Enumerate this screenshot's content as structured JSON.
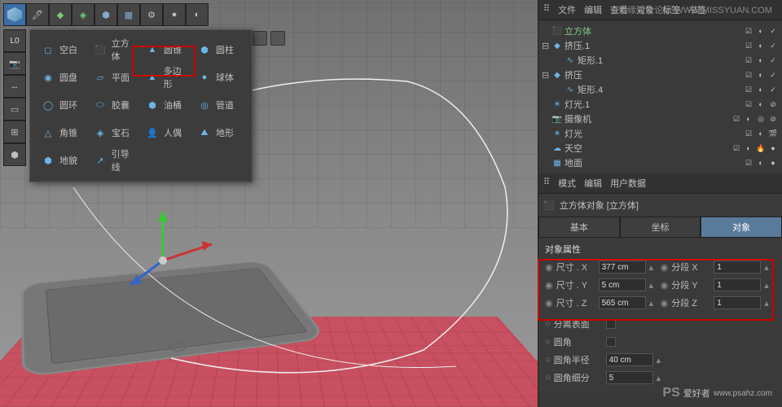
{
  "watermark_top": "思缘设计论坛  WWW.MISSYUAN.COM",
  "watermark_bottom": {
    "ps": "PS",
    "text": "爱好者",
    "url": "www.psahz.com"
  },
  "toolbar_side": [
    "L0",
    "cam",
    "move",
    "sel",
    "scale"
  ],
  "popup": {
    "rows": [
      [
        {
          "icon": "◻",
          "label": "空白"
        },
        {
          "icon": "⬛",
          "label": "立方体"
        },
        {
          "icon": "▲",
          "label": "圆锥"
        },
        {
          "icon": "⬢",
          "label": "圆柱"
        }
      ],
      [
        {
          "icon": "◉",
          "label": "圆盘"
        },
        {
          "icon": "▱",
          "label": "平面"
        },
        {
          "icon": "▲",
          "label": "多边形"
        },
        {
          "icon": "●",
          "label": "球体"
        }
      ],
      [
        {
          "icon": "◯",
          "label": "圆环"
        },
        {
          "icon": "⬭",
          "label": "胶囊"
        },
        {
          "icon": "⬢",
          "label": "油桶"
        },
        {
          "icon": "◎",
          "label": "管道"
        }
      ],
      [
        {
          "icon": "△",
          "label": "角锥"
        },
        {
          "icon": "◈",
          "label": "宝石"
        },
        {
          "icon": "👤",
          "label": "人偶"
        },
        {
          "icon": "⛰",
          "label": "地形"
        }
      ],
      [
        {
          "icon": "⬢",
          "label": "地貌"
        },
        {
          "icon": "↗",
          "label": "引导线"
        }
      ]
    ]
  },
  "obj_tabs": [
    "文件",
    "编辑",
    "查看",
    "对象",
    "标签",
    "书签"
  ],
  "hierarchy": [
    {
      "indent": 0,
      "toggle": "",
      "ico": "⬛",
      "name": "立方体",
      "cls": "green",
      "icons": [
        "☑",
        "◐",
        "✓"
      ]
    },
    {
      "indent": 0,
      "toggle": "⊟",
      "ico": "◆",
      "name": "挤压.1",
      "cls": "",
      "icons": [
        "☑",
        "◐",
        "✓"
      ]
    },
    {
      "indent": 1,
      "toggle": "",
      "ico": "∿",
      "name": "矩形.1",
      "cls": "",
      "icons": [
        "☑",
        "◐",
        "✓"
      ]
    },
    {
      "indent": 0,
      "toggle": "⊟",
      "ico": "◆",
      "name": "挤压",
      "cls": "",
      "icons": [
        "☑",
        "◐",
        "✓"
      ]
    },
    {
      "indent": 1,
      "toggle": "",
      "ico": "∿",
      "name": "矩形.4",
      "cls": "",
      "icons": [
        "☑",
        "◐",
        "✓"
      ]
    },
    {
      "indent": 0,
      "toggle": "",
      "ico": "☀",
      "name": "灯光.1",
      "cls": "",
      "icons": [
        "☑",
        "◐",
        "⊘"
      ]
    },
    {
      "indent": 0,
      "toggle": "",
      "ico": "📷",
      "name": "摄像机",
      "cls": "",
      "icons": [
        "☑",
        "◐",
        "◎",
        "⊘"
      ]
    },
    {
      "indent": 0,
      "toggle": "",
      "ico": "☀",
      "name": "灯光",
      "cls": "",
      "icons": [
        "☑",
        "◐",
        "🎬"
      ]
    },
    {
      "indent": 0,
      "toggle": "",
      "ico": "☁",
      "name": "天空",
      "cls": "",
      "icons": [
        "☑",
        "◐",
        "🔥",
        "●"
      ]
    },
    {
      "indent": 0,
      "toggle": "",
      "ico": "▦",
      "name": "地面",
      "cls": "",
      "icons": [
        "☑",
        "◐",
        "●"
      ]
    }
  ],
  "attr_tabs": [
    "模式",
    "编辑",
    "用户数据"
  ],
  "attr_header": {
    "ico": "⬛",
    "text": "立方体对象 [立方体]"
  },
  "attr_sub_tabs": [
    {
      "label": "基本",
      "active": false
    },
    {
      "label": "坐标",
      "active": false
    },
    {
      "label": "对象",
      "active": true
    }
  ],
  "attr_section_title": "对象属性",
  "props_size": [
    {
      "label": "尺寸 . X",
      "value": "377 cm",
      "seg_label": "分段 X",
      "seg_value": "1"
    },
    {
      "label": "尺寸 . Y",
      "value": "5 cm",
      "seg_label": "分段 Y",
      "seg_value": "1"
    },
    {
      "label": "尺寸 . Z",
      "value": "565 cm",
      "seg_label": "分段 Z",
      "seg_value": "1"
    }
  ],
  "props_extra": [
    {
      "label": "分离表面",
      "type": "check"
    },
    {
      "label": "圆角",
      "type": "check"
    },
    {
      "label": "圆角半径",
      "type": "input",
      "value": "40 cm"
    },
    {
      "label": "圆角细分",
      "type": "input",
      "value": "5"
    }
  ]
}
